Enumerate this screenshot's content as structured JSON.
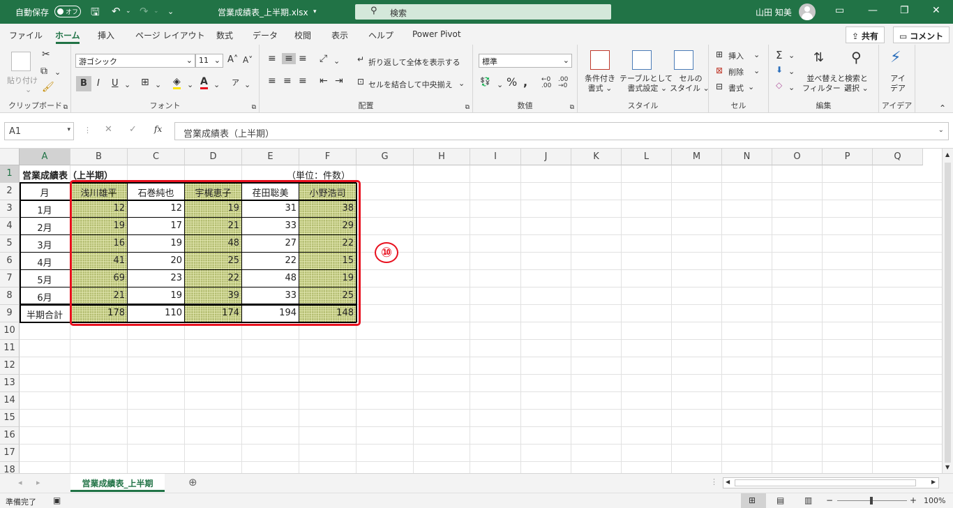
{
  "title_bar": {
    "autosave_label": "自動保存",
    "autosave_state": "オフ",
    "file_name": "営業成績表_上半期.xlsx",
    "search_placeholder": "検索",
    "user_name": "山田 知美"
  },
  "ribbon_tabs": [
    "ファイル",
    "ホーム",
    "挿入",
    "ページ レイアウト",
    "数式",
    "データ",
    "校閲",
    "表示",
    "ヘルプ",
    "Power Pivot"
  ],
  "share_label": "共有",
  "comment_label": "コメント",
  "ribbon": {
    "clipboard": {
      "paste": "貼り付け",
      "label": "クリップボード"
    },
    "font": {
      "name": "游ゴシック",
      "size": "11",
      "bold": "B",
      "italic": "I",
      "underline": "U",
      "label": "フォント"
    },
    "alignment": {
      "wrap": "折り返して全体を表示する",
      "merge": "セルを結合して中央揃え",
      "label": "配置"
    },
    "number": {
      "format": "標準",
      "label": "数値"
    },
    "styles": {
      "conditional": [
        "条件付き",
        "書式"
      ],
      "table": [
        "テーブルとして",
        "書式設定"
      ],
      "cell": [
        "セルの",
        "スタイル"
      ],
      "label": "スタイル"
    },
    "cells": {
      "insert": "挿入",
      "delete": "削除",
      "format": "書式",
      "label": "セル"
    },
    "editing": {
      "sort": [
        "並べ替えと",
        "フィルター"
      ],
      "find": [
        "検索と",
        "選択"
      ],
      "label": "編集"
    },
    "ideas": {
      "btn": [
        "アイ",
        "デア"
      ],
      "label": "アイデア"
    }
  },
  "formula_bar": {
    "name_box": "A1",
    "fx": "fx",
    "content": "営業成績表（上半期）"
  },
  "columns": [
    "A",
    "B",
    "C",
    "D",
    "E",
    "F",
    "G",
    "H",
    "I",
    "J",
    "K",
    "L",
    "M",
    "N",
    "O",
    "P",
    "Q"
  ],
  "rows": [
    "1",
    "2",
    "3",
    "4",
    "5",
    "6",
    "7",
    "8",
    "9",
    "10",
    "11",
    "12",
    "13",
    "14",
    "15",
    "16",
    "17",
    "18"
  ],
  "sheet": {
    "title": "営業成績表（上半期）",
    "unit": "（単位：件数）",
    "headers": [
      "月",
      "浅川雄平",
      "石巻純也",
      "宇梶恵子",
      "荏田聡美",
      "小野浩司"
    ],
    "data": [
      [
        "1月",
        "12",
        "12",
        "19",
        "31",
        "38"
      ],
      [
        "2月",
        "19",
        "17",
        "21",
        "33",
        "29"
      ],
      [
        "3月",
        "16",
        "19",
        "48",
        "27",
        "22"
      ],
      [
        "4月",
        "41",
        "20",
        "25",
        "22",
        "15"
      ],
      [
        "5月",
        "69",
        "23",
        "22",
        "48",
        "19"
      ],
      [
        "6月",
        "21",
        "19",
        "39",
        "33",
        "25"
      ]
    ],
    "totals": [
      "半期合計",
      "178",
      "110",
      "174",
      "194",
      "148"
    ]
  },
  "annotation": "⑩",
  "sheet_tab": "営業成績表_上半期",
  "status": {
    "ready": "準備完了",
    "zoom": "100%"
  },
  "colors": {
    "excel_green": "#217346",
    "highlight_red": "#e8101e"
  }
}
